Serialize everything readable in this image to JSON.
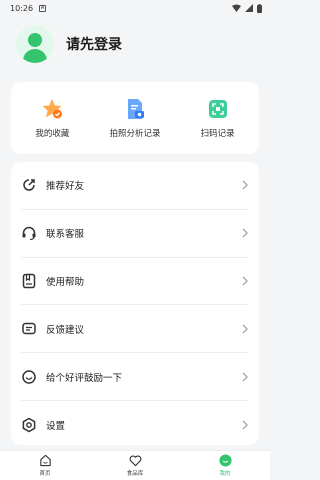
{
  "status_bar": {
    "time": "10:26",
    "notification_glyph": "A"
  },
  "profile": {
    "login_prompt": "请先登录"
  },
  "quick_actions": [
    {
      "label": "我的收藏",
      "icon": "star-icon"
    },
    {
      "label": "拍照分析记录",
      "icon": "photo-record-icon"
    },
    {
      "label": "扫码记录",
      "icon": "scan-icon"
    }
  ],
  "menu": [
    {
      "label": "推荐好友",
      "icon": "share-icon"
    },
    {
      "label": "联系客服",
      "icon": "headset-icon"
    },
    {
      "label": "使用帮助",
      "icon": "help-book-icon"
    },
    {
      "label": "反馈建议",
      "icon": "feedback-icon"
    },
    {
      "label": "给个好评鼓励一下",
      "icon": "smile-icon"
    },
    {
      "label": "设置",
      "icon": "settings-icon"
    }
  ],
  "tabs": [
    {
      "label": "首页",
      "icon": "home-icon"
    },
    {
      "label": "食品库",
      "icon": "heart-icon"
    },
    {
      "label": "我的",
      "icon": "profile-icon",
      "active": true
    }
  ],
  "colors": {
    "accent": "#35c46e",
    "background": "#f4f5f7",
    "card": "#ffffff"
  }
}
